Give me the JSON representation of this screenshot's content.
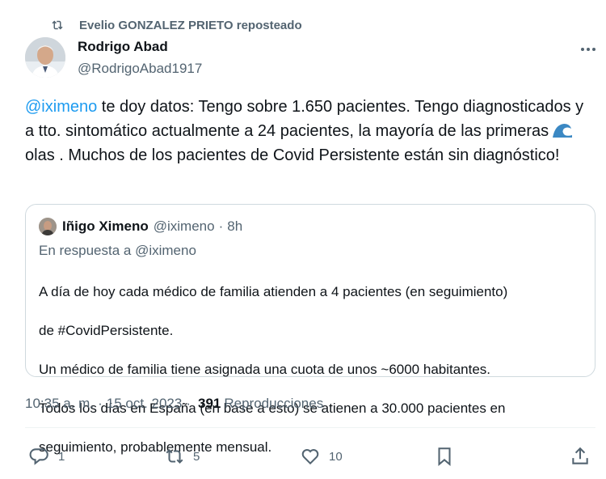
{
  "repost": {
    "label": "Evelio GONZALEZ PRIETO reposteado",
    "icon": "repost-icon"
  },
  "author": {
    "name": "Rodrigo Abad",
    "handle": "@RodrigoAbad1917"
  },
  "tweet": {
    "mention": "@iximeno",
    "text_part1": " te doy datos: Tengo sobre 1.650 pacientes. Tengo diagnosticados y a tto. sintomático actualmente a 24 pacientes, la mayoría de las primeras",
    "emoji": "wave-emoji-icon",
    "text_part2": " olas . Muchos de los pacientes de Covid Persistente están sin diagnóstico!"
  },
  "quote": {
    "name": "Iñigo Ximeno",
    "handle": "@iximeno",
    "separator": "·",
    "time": "8h",
    "reply_label": "En respuesta a @iximeno",
    "line1": "A día de hoy cada médico de familia atienden a 4 pacientes (en seguimiento)",
    "line2": "de #CovidPersistente.",
    "line3": "Un médico de familia tiene asignada una cuota de unos ~6000 habitantes.",
    "line4": "Todos los días en España (en base a esto) se atienen a 30.000 pacientes en",
    "line5": "seguimiento, probablemente mensual."
  },
  "meta": {
    "time": "10:35 a. m.",
    "separator": "·",
    "date": "15 oct. 2023",
    "separator2": "·",
    "views_count": "391",
    "views_label": "Reproducciones"
  },
  "actions": {
    "replies": "1",
    "reposts": "5",
    "likes": "10"
  },
  "colors": {
    "accent": "#1d9bf0",
    "muted": "#536471",
    "text": "#0f1419",
    "border": "#cfd9de"
  }
}
